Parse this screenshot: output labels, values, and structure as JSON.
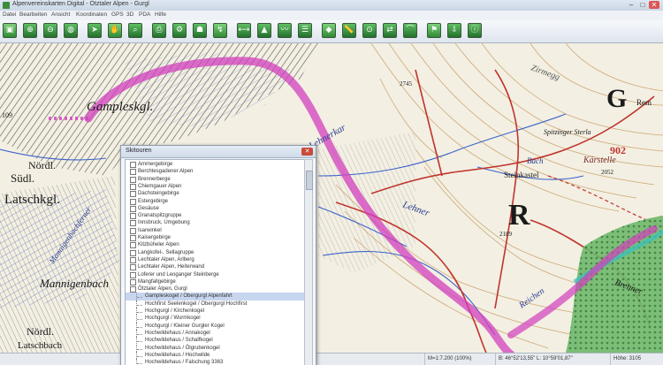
{
  "window": {
    "title": "Alpenvereinskarten Digital - Ötztaler Alpen - Gurgl",
    "controls": [
      "–",
      "□",
      "✕"
    ]
  },
  "menu": [
    "Datei",
    "Bearbeiten",
    "Ansicht",
    "Koordinaten",
    "GPS",
    "3D",
    "PDA",
    "Hilfe"
  ],
  "toolbar": {
    "buttons": [
      "open-icon",
      "zoom-in-icon",
      "zoom-out-icon",
      "globe-icon",
      "cursor-icon",
      "hand-icon",
      "magnifier-icon",
      "print-icon",
      "settings-icon",
      "hiker-icon",
      "route-icon",
      "measure-icon",
      "mountain-icon",
      "track-icon",
      "layers-icon",
      "waypoint-icon",
      "ruler-icon",
      "gps-icon",
      "transfer-icon",
      "profile-icon",
      "flag-icon",
      "download-icon",
      "info-icon"
    ]
  },
  "map": {
    "labels": {
      "gampleskgl": "Gampleskgl.",
      "nordl_sudl": "Nördl.",
      "sudl": "Südl.",
      "latschkgl": "Latschkgl.",
      "mannigenbach": "Mannigenbach",
      "mannigenbach_blue": "Mannigenbachferner",
      "nordl_bottom": "Nördl.",
      "latschbach": "Latschbach",
      "lehner": "Lehner",
      "lehnerkar": "Lehnerkar",
      "steinkastel": "Steinkastel",
      "zirmegg": "Zirmegg",
      "spitzinger_sterla": "Spitzinger Sterla",
      "karstelle": "Kärstelle",
      "brenner": "Brenner",
      "reiche": "Reichen",
      "manigenbach_bottom": "Manigen B.",
      "bach_label": "Bach",
      "rem": "Rem",
      "elev_2745": "2745",
      "elev_2189": "2189",
      "elev_2052": "2052",
      "elev_902": "902",
      "letter_r": "R",
      "letter_g": "G",
      "num_109": "109"
    }
  },
  "status": {
    "scale": "M=1:7.200 (100%)",
    "coords": "B: 46°52'13,55\"  L: 10°59'01,87\"",
    "height": "Höhe: 3105"
  },
  "dialog": {
    "title": "Skitouren",
    "close": "✕",
    "items": [
      {
        "label": "Ammergebirge",
        "selected": false,
        "child": false
      },
      {
        "label": "Berchtesgadener Alpen",
        "selected": false,
        "child": false
      },
      {
        "label": "Brennerberge",
        "selected": false,
        "child": false
      },
      {
        "label": "Chiemgauer Alpen",
        "selected": false,
        "child": false
      },
      {
        "label": "Dachsteingebirge",
        "selected": false,
        "child": false
      },
      {
        "label": "Estergebirge",
        "selected": false,
        "child": false
      },
      {
        "label": "Gesäuse",
        "selected": false,
        "child": false
      },
      {
        "label": "Granatspitzgruppe",
        "selected": false,
        "child": false
      },
      {
        "label": "Innsbruck, Umgebung",
        "selected": false,
        "child": false
      },
      {
        "label": "Isarwinkel",
        "selected": false,
        "child": false
      },
      {
        "label": "Kaisergebirge",
        "selected": false,
        "child": false
      },
      {
        "label": "Kitzbüheler Alpen",
        "selected": false,
        "child": false
      },
      {
        "label": "Langkofel-, Sellagruppe",
        "selected": false,
        "child": false
      },
      {
        "label": "Lechtaler Alpen, Arlberg",
        "selected": false,
        "child": false
      },
      {
        "label": "Lechtaler Alpen, Heiterwand",
        "selected": false,
        "child": false
      },
      {
        "label": "Loferer und Leoganger Steinberge",
        "selected": false,
        "child": false
      },
      {
        "label": "Mangfallgebirge",
        "selected": false,
        "child": false
      },
      {
        "label": "Ötztaler Alpen, Gurgl",
        "selected": false,
        "child": false
      },
      {
        "label": "Gampleskogel / Obergurgl Alpenfahrt",
        "selected": true,
        "child": true
      },
      {
        "label": "Hochfirst Seelenkogel / Obergurgl Hochfirst",
        "selected": false,
        "child": true
      },
      {
        "label": "Hochgurgl / Kirchenkogel",
        "selected": false,
        "child": true
      },
      {
        "label": "Hochgurgl / Wurmkogel",
        "selected": false,
        "child": true
      },
      {
        "label": "Hochgurgl / Kleiner Gurgler Kogel",
        "selected": false,
        "child": true
      },
      {
        "label": "Hochwildehaus / Annakogel",
        "selected": false,
        "child": true
      },
      {
        "label": "Hochwildehaus / Schalfkogel",
        "selected": false,
        "child": true
      },
      {
        "label": "Hochwildehaus / Ölgrubenkogel",
        "selected": false,
        "child": true
      },
      {
        "label": "Hochwildehaus / Hochwilde",
        "selected": false,
        "child": true
      },
      {
        "label": "Hochwildehaus / Falschung 3363",
        "selected": false,
        "child": true
      }
    ]
  },
  "colors": {
    "route": "#d23fbe",
    "contour": "#c9a36a",
    "trail": "#c0342b",
    "water": "#3b63c9",
    "glacier": "#5470c8",
    "forest": "#4f9b4f"
  }
}
